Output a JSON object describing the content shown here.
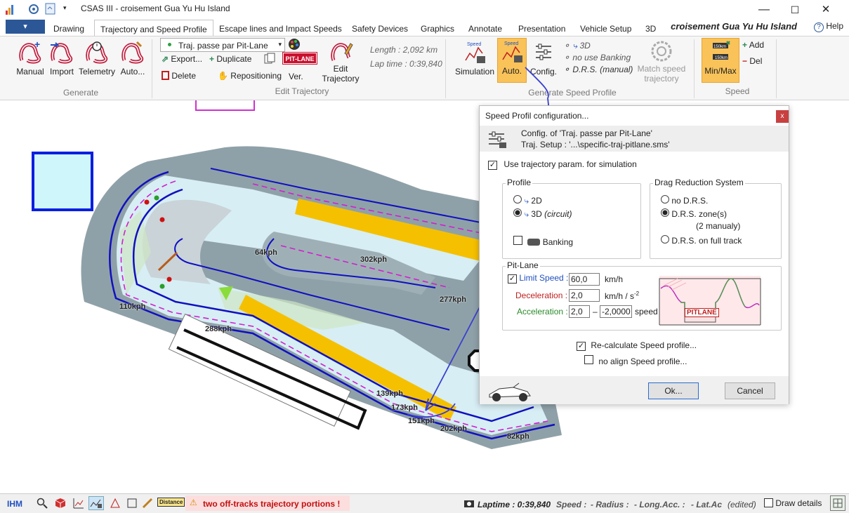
{
  "window": {
    "title": "CSAS III - croisement Gua Yu Hu Island",
    "min": "—",
    "max": "☐",
    "close": "✕"
  },
  "tabs": [
    {
      "label": "Drawing"
    },
    {
      "label": "Trajectory and Speed Profile"
    },
    {
      "label": "Escape lines and Impact Speeds"
    },
    {
      "label": "Safety Devices"
    },
    {
      "label": "Graphics"
    },
    {
      "label": "Annotate"
    },
    {
      "label": "Presentation"
    },
    {
      "label": "Vehicle Setup"
    },
    {
      "label": "3D"
    }
  ],
  "circuit_title": "croisement Gua Yu Hu Island",
  "help": "Help",
  "ribbon": {
    "generate": {
      "label": "Generate",
      "buttons": [
        "Manual",
        "Import",
        "Telemetry",
        "Auto..."
      ]
    },
    "edit": {
      "label": "Edit Trajectory",
      "selector": "Traj. passe par Pit-Lane",
      "export": "Export...",
      "duplicate": "Duplicate",
      "pitlane": "PIT-LANE",
      "delete": "Delete",
      "repositioning": "Repositioning",
      "ver": "Ver.",
      "edit_traj_1": "Edit",
      "edit_traj_2": "Trajectory",
      "length": "Length : 2,092 km",
      "lap_time": "Lap time : 0:39,840"
    },
    "speed_profile": {
      "label": "Generate Speed Profile",
      "simulation": "Simulation",
      "auto": "Auto.",
      "config": "Config.",
      "opt_3d": "3D",
      "opt_banking": "no use Banking",
      "opt_drs": "D.R.S. (manual)",
      "match_1": "Match speed",
      "match_2": "trajectory"
    },
    "speed": {
      "label": "Speed",
      "minmax": "Min/Max",
      "add": "Add",
      "del": "Del"
    }
  },
  "map": {
    "speeds": [
      "64kph",
      "302kph",
      "277kph",
      "110kph",
      "288kph",
      "139kph",
      "173kph",
      "151kph",
      "202kph",
      "82kph"
    ]
  },
  "dialog": {
    "title": "Speed Profil configuration...",
    "config_of": "Config. of 'Traj. passe par Pit-Lane'",
    "traj_setup": "Traj. Setup : '...\\specific-traj-pitlane.sms'",
    "use_traj_param": "Use trajectory param. for simulation",
    "profile": {
      "legend": "Profile",
      "opt_2d": "2D",
      "opt_3d": "3D",
      "opt_3d_suffix": "(circuit)",
      "banking": "Banking"
    },
    "drs": {
      "legend": "Drag Reduction System",
      "none": "no D.R.S.",
      "zones": "D.R.S. zone(s)",
      "zones_note": "(2 manualy)",
      "full": "D.R.S. on full track"
    },
    "pitlane": {
      "legend": "Pit-Lane",
      "limit_label": "Limit Speed :",
      "limit_value": "60,0",
      "limit_unit": "km/h",
      "decel_label": "Deceleration :",
      "decel_value": "2,0",
      "decel_unit": "km/h / s",
      "accel_label": "Acceleration :",
      "accel_value": "2,0",
      "accel_dash": "–",
      "accel_value2": "-2,0000",
      "accel_unit": "speed",
      "chart_label": "PITLANE"
    },
    "recalc": "Re-calculate Speed profile...",
    "no_align": "no align Speed profile...",
    "ok": "Ok...",
    "cancel": "Cancel"
  },
  "statusbar": {
    "ihm": "IHM",
    "warning": "two off-tracks trajectory portions !",
    "laptime": "Laptime : 0:39,840",
    "speed": "Speed :",
    "radius": "- Radius :",
    "long_acc": "- Long.Acc. :",
    "lat_acc": "- Lat.Acc",
    "edited": "(edited)",
    "draw_details": "Draw details"
  }
}
